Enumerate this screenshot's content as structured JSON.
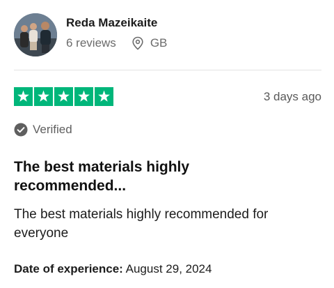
{
  "reviewer": {
    "name": "Reda Mazeikaite",
    "reviews": "6 reviews",
    "country": "GB"
  },
  "rating": {
    "stars": 5,
    "max_stars": 5,
    "star_color": "#00b67a",
    "time_ago": "3 days ago"
  },
  "verification": {
    "label": "Verified"
  },
  "review": {
    "title_line1": "The best materials highly",
    "title_line2": "recommended...",
    "body_line1": "The best materials highly recommended for",
    "body_line2": "everyone"
  },
  "experience": {
    "label": "Date of experience:",
    "date": "August 29, 2024"
  },
  "icons": {
    "location": "map-pin-icon",
    "verified": "check-circle-icon",
    "star": "star-icon"
  }
}
